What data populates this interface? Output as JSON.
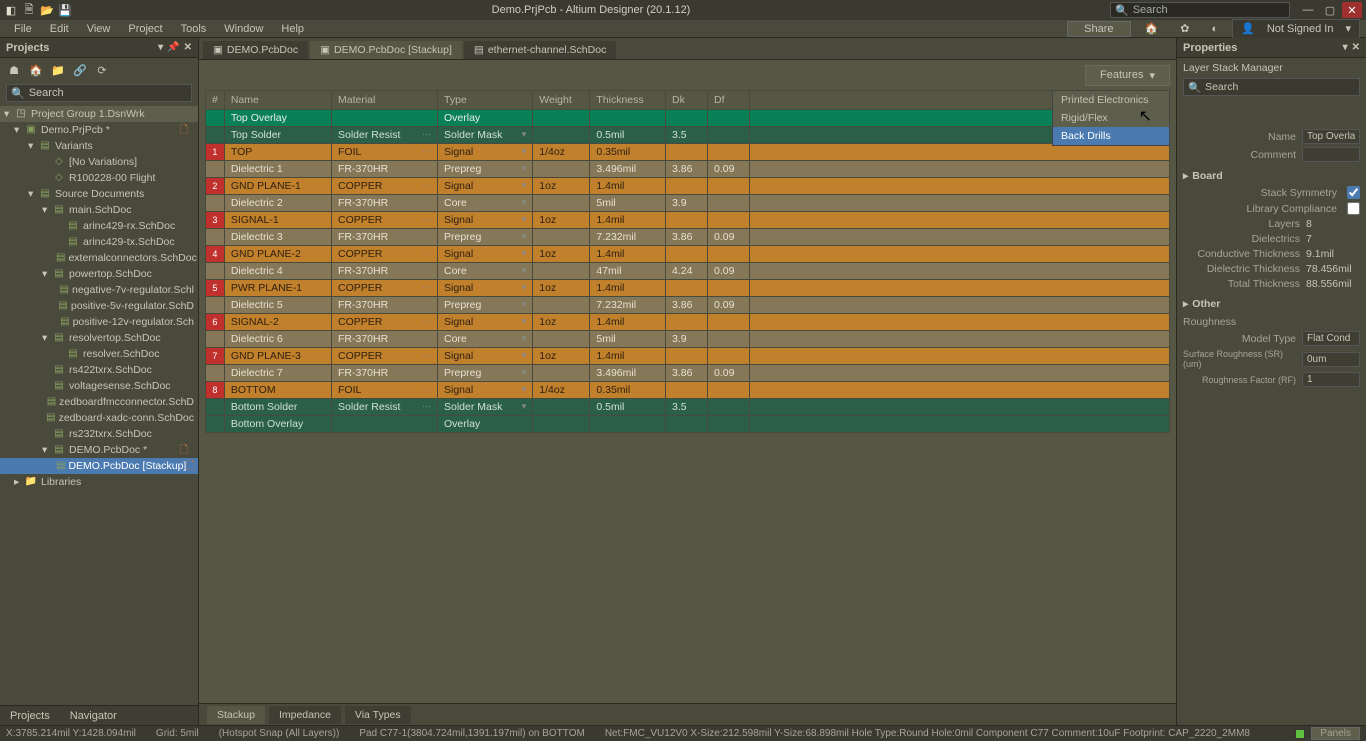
{
  "app": {
    "title": "Demo.PrjPcb - Altium Designer (20.1.12)",
    "search_placeholder": "Search"
  },
  "menu": {
    "items": [
      "File",
      "Edit",
      "View",
      "Project",
      "Tools",
      "Window",
      "Help"
    ],
    "share": "Share",
    "signin": "Not Signed In"
  },
  "projects": {
    "title": "Projects",
    "search": "Search",
    "group": "Project Group 1.DsnWrk",
    "root": "Demo.PrjPcb *",
    "tree": [
      {
        "label": "Variants",
        "level": 3,
        "expand": "▾"
      },
      {
        "label": "[No Variations]",
        "level": 4,
        "icon": "var"
      },
      {
        "label": "R100228-00 Flight",
        "level": 4,
        "icon": "var"
      },
      {
        "label": "Source Documents",
        "level": 3,
        "expand": "▾"
      },
      {
        "label": "main.SchDoc",
        "level": 4,
        "expand": "▾",
        "icon": "doc"
      },
      {
        "label": "arinc429-rx.SchDoc",
        "level": 5,
        "icon": "doc"
      },
      {
        "label": "arinc429-tx.SchDoc",
        "level": 5,
        "icon": "doc"
      },
      {
        "label": "externalconnectors.SchDoc",
        "level": 5,
        "icon": "doc"
      },
      {
        "label": "powertop.SchDoc",
        "level": 4,
        "expand": "▾",
        "icon": "doc"
      },
      {
        "label": "negative-7v-regulator.Schl",
        "level": 5,
        "icon": "doc"
      },
      {
        "label": "positive-5v-regulator.SchD",
        "level": 5,
        "icon": "doc"
      },
      {
        "label": "positive-12v-regulator.Sch",
        "level": 5,
        "icon": "doc"
      },
      {
        "label": "resolvertop.SchDoc",
        "level": 4,
        "expand": "▾",
        "icon": "doc"
      },
      {
        "label": "resolver.SchDoc",
        "level": 5,
        "icon": "doc"
      },
      {
        "label": "rs422txrx.SchDoc",
        "level": 4,
        "icon": "doc"
      },
      {
        "label": "voltagesense.SchDoc",
        "level": 4,
        "icon": "doc"
      },
      {
        "label": "zedboardfmcconnector.SchD",
        "level": 4,
        "icon": "doc"
      },
      {
        "label": "zedboard-xadc-conn.SchDoc",
        "level": 4,
        "icon": "doc"
      },
      {
        "label": "rs232txrx.SchDoc",
        "level": 4,
        "icon": "doc"
      },
      {
        "label": "DEMO.PcbDoc *",
        "level": 4,
        "expand": "▾",
        "icon": "pcb",
        "dirty": true
      },
      {
        "label": "DEMO.PcbDoc [Stackup]",
        "level": 5,
        "icon": "pcb",
        "selected": true,
        "dirty": true
      },
      {
        "label": "Libraries",
        "level": 2,
        "expand": "▸",
        "icon": "folder"
      }
    ],
    "tabs": [
      "Projects",
      "Navigator"
    ]
  },
  "docTabs": [
    {
      "label": "DEMO.PcbDoc",
      "icon": "▣"
    },
    {
      "label": "DEMO.PcbDoc [Stackup]",
      "icon": "▣",
      "active": true
    },
    {
      "label": "ethernet-channel.SchDoc",
      "icon": "▤"
    }
  ],
  "features": {
    "label": "Features",
    "menu": [
      "Printed Electronics",
      "Rigid/Flex",
      "Back Drills"
    ]
  },
  "grid": {
    "headers": [
      "#",
      "Name",
      "Material",
      "Type",
      "Weight",
      "Thickness",
      "Dk",
      "Df",
      ""
    ],
    "rows": [
      {
        "num": "",
        "name": "Top Overlay",
        "material": "",
        "type": "Overlay",
        "weight": "",
        "thickness": "",
        "dk": "",
        "df": "",
        "cls": "row-green-sel"
      },
      {
        "num": "",
        "name": "Top Solder",
        "material": "Solder Resist",
        "type": "Solder Mask",
        "weight": "",
        "thickness": "0.5mil",
        "dk": "3.5",
        "df": "",
        "cls": "row-green"
      },
      {
        "num": "1",
        "name": "TOP",
        "material": "FOIL",
        "type": "Signal",
        "weight": "1/4oz",
        "thickness": "0.35mil",
        "dk": "",
        "df": "",
        "cls": "row-copper"
      },
      {
        "num": "",
        "name": "Dielectric 1",
        "material": "FR-370HR",
        "type": "Prepreg",
        "weight": "",
        "thickness": "3.496mil",
        "dk": "3.86",
        "df": "0.09",
        "cls": "row-dielectric"
      },
      {
        "num": "2",
        "name": "GND PLANE-1",
        "material": "COPPER",
        "type": "Signal",
        "weight": "1oz",
        "thickness": "1.4mil",
        "dk": "",
        "df": "",
        "cls": "row-copper"
      },
      {
        "num": "",
        "name": "Dielectric 2",
        "material": "FR-370HR",
        "type": "Core",
        "weight": "",
        "thickness": "5mil",
        "dk": "3.9",
        "df": "",
        "cls": "row-dielectric"
      },
      {
        "num": "3",
        "name": "SIGNAL-1",
        "material": "COPPER",
        "type": "Signal",
        "weight": "1oz",
        "thickness": "1.4mil",
        "dk": "",
        "df": "",
        "cls": "row-copper"
      },
      {
        "num": "",
        "name": "Dielectric 3",
        "material": "FR-370HR",
        "type": "Prepreg",
        "weight": "",
        "thickness": "7.232mil",
        "dk": "3.86",
        "df": "0.09",
        "cls": "row-dielectric"
      },
      {
        "num": "4",
        "name": "GND PLANE-2",
        "material": "COPPER",
        "type": "Signal",
        "weight": "1oz",
        "thickness": "1.4mil",
        "dk": "",
        "df": "",
        "cls": "row-copper"
      },
      {
        "num": "",
        "name": "Dielectric 4",
        "material": "FR-370HR",
        "type": "Core",
        "weight": "",
        "thickness": "47mil",
        "dk": "4.24",
        "df": "0.09",
        "cls": "row-dielectric"
      },
      {
        "num": "5",
        "name": "PWR PLANE-1",
        "material": "COPPER",
        "type": "Signal",
        "weight": "1oz",
        "thickness": "1.4mil",
        "dk": "",
        "df": "",
        "cls": "row-copper"
      },
      {
        "num": "",
        "name": "Dielectric 5",
        "material": "FR-370HR",
        "type": "Prepreg",
        "weight": "",
        "thickness": "7.232mil",
        "dk": "3.86",
        "df": "0.09",
        "cls": "row-dielectric"
      },
      {
        "num": "6",
        "name": "SIGNAL-2",
        "material": "COPPER",
        "type": "Signal",
        "weight": "1oz",
        "thickness": "1.4mil",
        "dk": "",
        "df": "",
        "cls": "row-copper"
      },
      {
        "num": "",
        "name": "Dielectric 6",
        "material": "FR-370HR",
        "type": "Core",
        "weight": "",
        "thickness": "5mil",
        "dk": "3.9",
        "df": "",
        "cls": "row-dielectric"
      },
      {
        "num": "7",
        "name": "GND PLANE-3",
        "material": "COPPER",
        "type": "Signal",
        "weight": "1oz",
        "thickness": "1.4mil",
        "dk": "",
        "df": "",
        "cls": "row-copper"
      },
      {
        "num": "",
        "name": "Dielectric 7",
        "material": "FR-370HR",
        "type": "Prepreg",
        "weight": "",
        "thickness": "3.496mil",
        "dk": "3.86",
        "df": "0.09",
        "cls": "row-dielectric"
      },
      {
        "num": "8",
        "name": "BOTTOM",
        "material": "FOIL",
        "type": "Signal",
        "weight": "1/4oz",
        "thickness": "0.35mil",
        "dk": "",
        "df": "",
        "cls": "row-copper"
      },
      {
        "num": "",
        "name": "Bottom Solder",
        "material": "Solder Resist",
        "type": "Solder Mask",
        "weight": "",
        "thickness": "0.5mil",
        "dk": "3.5",
        "df": "",
        "cls": "row-green"
      },
      {
        "num": "",
        "name": "Bottom Overlay",
        "material": "",
        "type": "Overlay",
        "weight": "",
        "thickness": "",
        "dk": "",
        "df": "",
        "cls": "row-green"
      }
    ],
    "bottomTabs": [
      "Stackup",
      "Impedance",
      "Via Types"
    ]
  },
  "props": {
    "title": "Properties",
    "subtitle": "Layer Stack Manager",
    "search": "Search",
    "name_label": "Name",
    "name_value": "Top Overlay",
    "comment_label": "Comment",
    "comment_value": "",
    "board": "Board",
    "stack_sym": "Stack Symmetry",
    "lib_comp": "Library Compliance",
    "layers_label": "Layers",
    "layers_value": "8",
    "diel_label": "Dielectrics",
    "diel_value": "7",
    "cond_label": "Conductive Thickness",
    "cond_value": "9.1mil",
    "dielt_label": "Dielectric Thickness",
    "dielt_value": "78.456mil",
    "total_label": "Total Thickness",
    "total_value": "88.556mil",
    "other": "Other",
    "roughness": "Roughness",
    "model_label": "Model Type",
    "model_value": "Flat Cond",
    "surf_label": "Surface Roughness (SR) (um)",
    "surf_value": "0um",
    "rfac_label": "Roughness Factor (RF)",
    "rfac_value": "1"
  },
  "statusbar": {
    "coords": "X:3785.214mil Y:1428.094mil",
    "grid": "Grid: 5mil",
    "snap": "(Hotspot Snap (All Layers))",
    "pad": "Pad C77-1(3804.724mil,1391.197mil) on BOTTOM",
    "net": "Net:FMC_VU12V0 X-Size:212.598mil Y-Size:68.898mil Hole Type:Round Hole:0mil   Component C77 Comment:10uF Footprint: CAP_2220_2MM8",
    "panels": "Panels"
  }
}
